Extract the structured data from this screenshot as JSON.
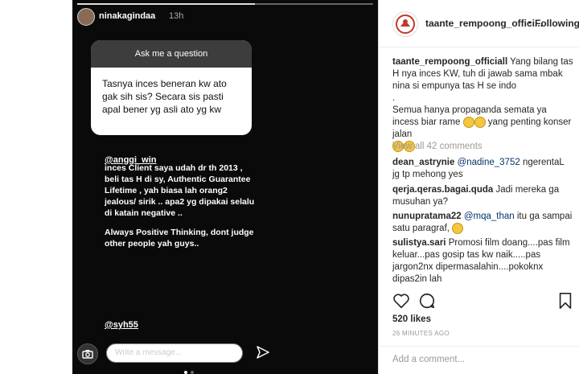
{
  "story": {
    "username": "ninakagindaa",
    "time": "13h",
    "question_header": "Ask me a question",
    "question_text": "Tasnya inces beneran kw ato gak sih sis? Secara sis pasti apal bener yg asli ato yg kw",
    "mention_top": "@anggi_win",
    "reply_paragraphs": [
      "inces Client saya udah dr th 2013 , beli tas H di sy, Authentic Guarantee Lifetime , yah biasa lah orang2 jealous/ sirik .. apa2 yg dipakai selalu di katain negative ..",
      "Always Positive Thinking, dont judge other people yah guys.."
    ],
    "mention_bottom": "@syh55",
    "message_placeholder": "Write a message..."
  },
  "post": {
    "account": "taante_rempoong_offici...",
    "follow_label": "Following",
    "caption_user": "taante_rempoong_officiall",
    "caption_text": "Yang bilang tas H nya inces KW, tuh di jawab sama mbak nina si empunya tas H se indo",
    "caption_dot": ".",
    "caption_text2": "Semua hanya propaganda semata ya incess biar rame",
    "caption_text3": "yang penting konser jalan",
    "view_all": "View all 42 comments",
    "comments": [
      {
        "user": "dean_astrynie",
        "mention": "@nadine_3752",
        "text": "ngerentaL jg tp mehong yes"
      },
      {
        "user": "qerja.qeras.bagai.quda",
        "mention": "",
        "text": "Jadi mereka ga musuhan ya?"
      },
      {
        "user": "nunupratama22",
        "mention": "@mqa_than",
        "text": "itu ga sampai satu paragraf,"
      },
      {
        "user": "sulistya.sari",
        "mention": "",
        "text": "Promosi film doang....pas film keluar...pas gosip tas kw naik.....pas jargon2nx dipermasalahin....pokoknx dipas2in lah"
      }
    ],
    "likes": "520 likes",
    "time_ago": "26 MINUTES AGO",
    "add_comment": "Add a comment..."
  },
  "icons": [
    "camera-icon",
    "send-icon",
    "heart-icon",
    "comment-icon",
    "bookmark-icon",
    "emoji-icon"
  ]
}
